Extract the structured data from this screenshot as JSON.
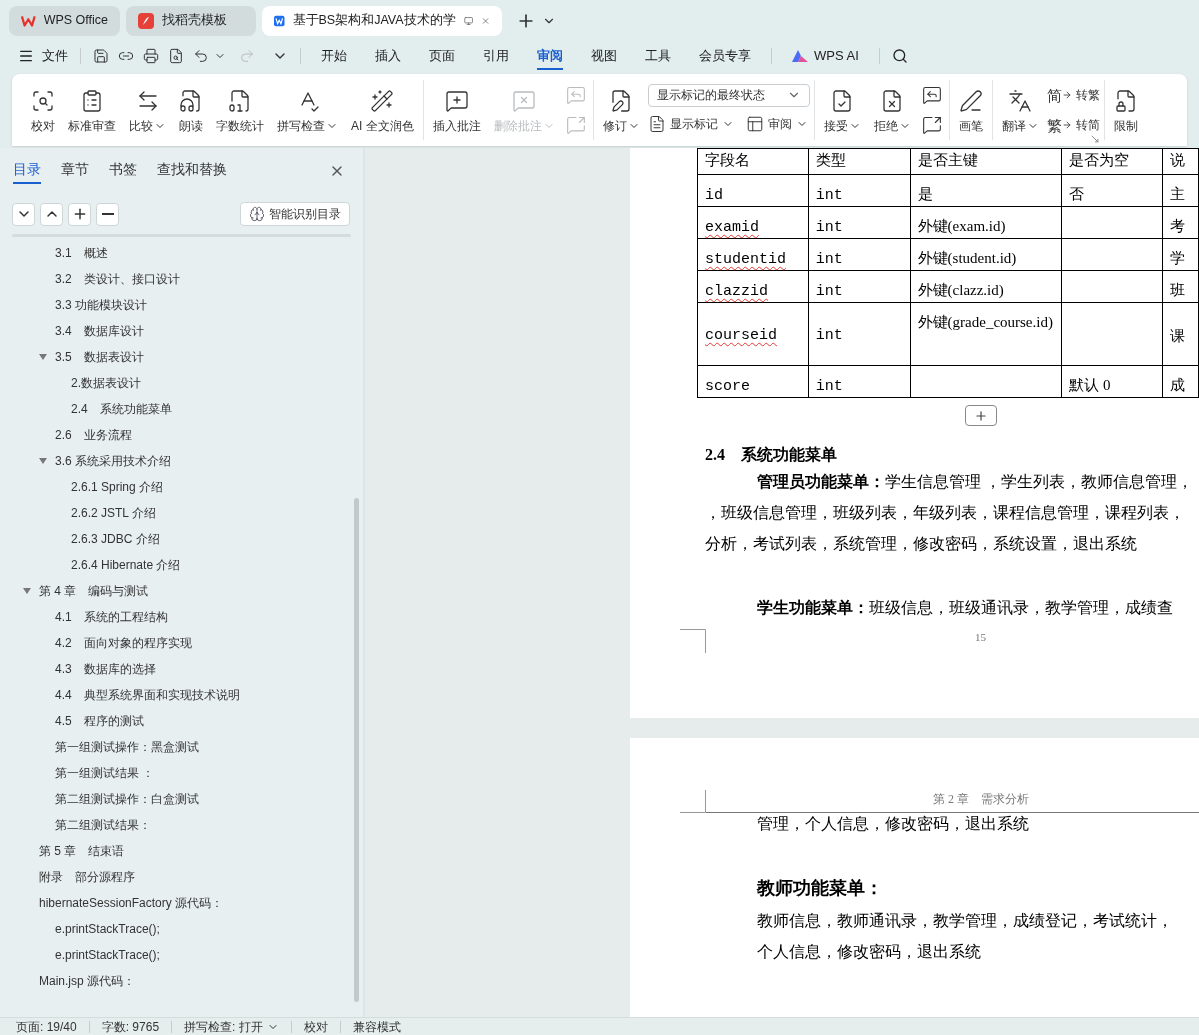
{
  "tabs": [
    {
      "label": "WPS Office",
      "kind": "home",
      "selected": false
    },
    {
      "label": "找稻壳模板",
      "kind": "template",
      "selected": false
    },
    {
      "label": "基于BS架构和JAVA技术的学",
      "kind": "document",
      "selected": true
    }
  ],
  "menu": {
    "file": "文件",
    "redo_disabled": true,
    "tabs": [
      {
        "label": "开始",
        "selected": false
      },
      {
        "label": "插入",
        "selected": false
      },
      {
        "label": "页面",
        "selected": false
      },
      {
        "label": "引用",
        "selected": false
      },
      {
        "label": "审阅",
        "selected": true
      },
      {
        "label": "视图",
        "selected": false
      },
      {
        "label": "工具",
        "selected": false
      },
      {
        "label": "会员专享",
        "selected": false
      }
    ],
    "ai": "WPS AI"
  },
  "ribbon": {
    "groups": [
      {
        "columns": [
          [
            {
              "kind": "large",
              "label": "校对",
              "dropdown": false,
              "disabled": false
            }
          ],
          [
            {
              "kind": "large",
              "label": "标准审查",
              "dropdown": false,
              "disabled": false
            }
          ],
          [
            {
              "kind": "large",
              "label": "比较",
              "dropdown": true,
              "disabled": false
            }
          ],
          [
            {
              "kind": "large",
              "label": "朗读",
              "dropdown": false,
              "disabled": false
            }
          ],
          [
            {
              "kind": "large",
              "label": "字数统计",
              "dropdown": false,
              "disabled": false
            }
          ],
          [
            {
              "kind": "large",
              "label": "拼写检查",
              "dropdown": true,
              "disabled": false
            }
          ],
          [
            {
              "kind": "large",
              "label": "AI 全文润色",
              "dropdown": false,
              "disabled": false
            }
          ]
        ]
      },
      {
        "columns": [
          [
            {
              "kind": "large",
              "label": "插入批注",
              "dropdown": false,
              "disabled": false
            }
          ],
          [
            {
              "kind": "large",
              "label": "删除批注",
              "dropdown": true,
              "disabled": true
            }
          ],
          [
            {
              "kind": "icon",
              "disabled": true
            },
            {
              "kind": "icon",
              "disabled": true
            }
          ]
        ]
      },
      {
        "columns": [
          [
            {
              "kind": "large",
              "label": "修订",
              "dropdown": true,
              "disabled": false
            }
          ],
          [
            {
              "kind": "select",
              "value": "显示标记的最终状态"
            },
            {
              "kind": "row",
              "items": [
                {
                  "kind": "small",
                  "label": "显示标记",
                  "dropdown": true,
                  "disabled": false
                },
                {
                  "kind": "small",
                  "label": "审阅",
                  "dropdown": true,
                  "disabled": false
                }
              ]
            }
          ]
        ]
      },
      {
        "columns": [
          [
            {
              "kind": "large",
              "label": "接受",
              "dropdown": true,
              "disabled": false
            }
          ],
          [
            {
              "kind": "large",
              "label": "拒绝",
              "dropdown": true,
              "disabled": false
            }
          ],
          [
            {
              "kind": "icon",
              "disabled": false
            },
            {
              "kind": "icon",
              "disabled": false
            }
          ]
        ]
      },
      {
        "columns": [
          [
            {
              "kind": "large",
              "label": "画笔",
              "dropdown": false,
              "disabled": false
            }
          ]
        ]
      },
      {
        "columns": [
          [
            {
              "kind": "large",
              "label": "翻译",
              "dropdown": true,
              "disabled": false
            }
          ],
          [
            {
              "kind": "small",
              "glyph": "简",
              "label": "转繁",
              "dropdown": false,
              "disabled": false
            },
            {
              "kind": "small",
              "glyph": "繁",
              "label": "转简",
              "dropdown": false,
              "disabled": false
            }
          ]
        ],
        "launcher": true
      },
      {
        "columns": [
          [
            {
              "kind": "large",
              "label": "限制",
              "dropdown": false,
              "disabled": false
            }
          ]
        ]
      }
    ]
  },
  "panel": {
    "tabs": [
      {
        "label": "目录",
        "selected": true
      },
      {
        "label": "章节",
        "selected": false
      },
      {
        "label": "书签",
        "selected": false
      },
      {
        "label": "查找和替换",
        "selected": false
      }
    ],
    "smart_button": "智能识别目录",
    "toc": [
      {
        "children": [
          {
            "label": "3.1　概述"
          },
          {
            "label": "3.2　类设计、接口设计"
          },
          {
            "label": "3.3 功能模块设计"
          },
          {
            "label": "3.4　数据库设计"
          },
          {
            "label": "3.5　数据表设计",
            "expanded": true,
            "children": [
              {
                "label": "2.数据表设计"
              },
              {
                "label": "2.4　系统功能菜单"
              }
            ]
          },
          {
            "label": "2.6　业务流程"
          },
          {
            "label": "3.6 系统采用技术介绍",
            "expanded": true,
            "children": [
              {
                "label": "2.6.1 Spring 介绍"
              },
              {
                "label": "2.6.2 JSTL 介绍"
              },
              {
                "label": "2.6.3 JDBC 介绍"
              },
              {
                "label": "2.6.4 Hibernate 介绍"
              }
            ]
          }
        ]
      },
      {
        "label": "第 4 章　编码与测试",
        "expanded": true,
        "children": [
          {
            "label": "4.1　系统的工程结构"
          },
          {
            "label": "4.2　面向对象的程序实现"
          },
          {
            "label": "4.3　数据库的选择"
          },
          {
            "label": "4.4　典型系统界面和实现技术说明"
          },
          {
            "label": "4.5　程序的测试"
          },
          {
            "label": "第一组测试操作：黑盒测试"
          },
          {
            "label": "第一组测试结果 ："
          },
          {
            "label": "第二组测试操作：白盒测试"
          },
          {
            "label": "第二组测试结果："
          }
        ]
      },
      {
        "label": "第 5 章　结束语"
      },
      {
        "label": "附录　部分源程序"
      },
      {
        "label": "hibernateSessionFactory 源代码：",
        "children": [
          {
            "label": "e.printStackTrace();"
          },
          {
            "label": "e.printStackTrace();"
          }
        ]
      },
      {
        "label": "Main.jsp 源代码："
      }
    ]
  },
  "document": {
    "table": {
      "columns": [
        "字段名",
        "类型",
        "是否主键",
        "是否为空",
        "说"
      ],
      "rows": [
        {
          "cells": [
            "id",
            "int",
            "是",
            "否",
            "主"
          ],
          "flagged": false
        },
        {
          "cells": [
            "examid",
            "int",
            "外键(exam.id)",
            "",
            "考"
          ],
          "flagged": true
        },
        {
          "cells": [
            "studentid",
            "int",
            "外键(student.id)",
            "",
            "学"
          ],
          "flagged": true
        },
        {
          "cells": [
            "clazzid",
            "int",
            "外键(clazz.id)",
            "",
            "班"
          ],
          "flagged": true
        },
        {
          "cells": [
            "courseid",
            "int",
            "外键(grade_course.id)",
            "",
            "课"
          ],
          "flagged": true
        },
        {
          "cells": [
            "score",
            "int",
            "",
            "默认 0",
            "成"
          ],
          "flagged": false
        }
      ]
    },
    "heading": "2.4　系统功能菜单",
    "admin_lines": [
      "**管理员功能菜单：**学生信息管理 ，学生列表，教师信息管理，",
      "，班级信息管理，班级列表，年级列表，课程信息管理，课程列表，",
      "分析，考试列表，系统管理，修改密码，系统设置，退出系统"
    ],
    "student_line": "**学生功能菜单：**班级信息，班级通讯录，教学管理，成绩查",
    "page_number": "15",
    "page2_header": "第 2 章　需求分析",
    "page2_first_line": "管理，个人信息，修改密码，退出系统",
    "teacher_heading": "教师功能菜单：",
    "teacher_lines": [
      "教师信息，教师通讯录，教学管理，成绩登记，考试统计，",
      "个人信息，修改密码，退出系统"
    ]
  },
  "status_bar": [
    {
      "label": "页面: 19/40",
      "dropdown": false
    },
    {
      "label": "字数: 9765",
      "dropdown": false
    },
    {
      "label": "拼写检查: 打开",
      "dropdown": true
    },
    {
      "label": "校对",
      "dropdown": false
    },
    {
      "label": "兼容模式",
      "dropdown": false
    }
  ]
}
